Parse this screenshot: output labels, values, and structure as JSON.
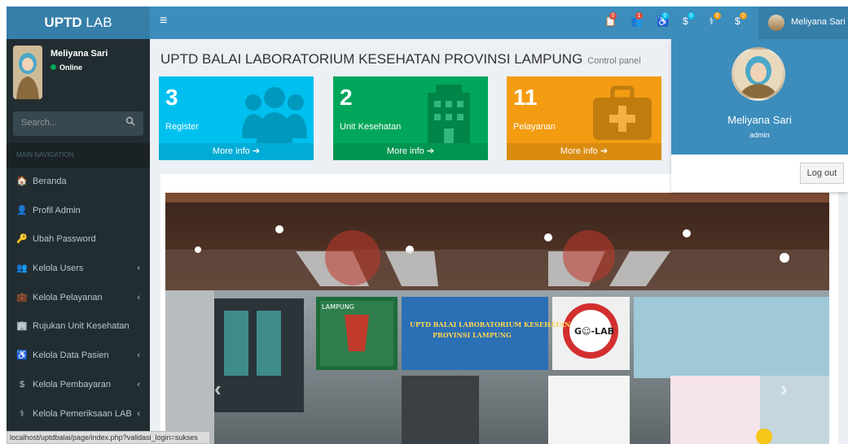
{
  "logo": {
    "bold": "UPTD",
    "rest": " LAB"
  },
  "sidebar": {
    "user_name": "Meliyana Sari",
    "status": "Online",
    "search_placeholder": "Search...",
    "nav_header": "MAIN NAVIGATION",
    "items": [
      {
        "label": "Beranda",
        "icon": "home-icon",
        "glyph": "🏠",
        "chevron": ""
      },
      {
        "label": "Profil Admin",
        "icon": "user-icon",
        "glyph": "👤",
        "chevron": ""
      },
      {
        "label": "Ubah Password",
        "icon": "key-icon",
        "glyph": "🔑",
        "chevron": ""
      },
      {
        "label": "Kelola Users",
        "icon": "users-icon",
        "glyph": "👥",
        "chevron": "‹"
      },
      {
        "label": "Kelola Pelayanan",
        "icon": "briefcase-medical-icon",
        "glyph": "💼",
        "chevron": "‹"
      },
      {
        "label": "Rujukan Unit Kesehatan",
        "icon": "building-icon",
        "glyph": "🏢",
        "chevron": ""
      },
      {
        "label": "Kelola Data Pasien",
        "icon": "wheelchair-icon",
        "glyph": "♿",
        "chevron": "‹"
      },
      {
        "label": "Kelola Pembayaran",
        "icon": "dollar-icon",
        "glyph": "$",
        "chevron": "‹"
      },
      {
        "label": "Kelola Pemeriksaan LAB",
        "icon": "stethoscope-icon",
        "glyph": "⚕",
        "chevron": "‹"
      }
    ]
  },
  "header": {
    "user_name": "Meliyana Sari",
    "notifications": [
      {
        "icon": "clipboard-icon",
        "glyph": "📋",
        "badge": "0",
        "color": "#dd4b39"
      },
      {
        "icon": "users-icon",
        "glyph": "👥",
        "badge": "1",
        "color": "#dd4b39"
      },
      {
        "icon": "wheelchair-icon",
        "glyph": "♿",
        "badge": "0",
        "color": "#00c0ef"
      },
      {
        "icon": "dollar-icon",
        "glyph": "$",
        "badge": "0",
        "color": "#00c0ef"
      },
      {
        "icon": "stethoscope-icon",
        "glyph": "⚕",
        "badge": "0",
        "color": "#f39c12"
      },
      {
        "icon": "dollar-icon",
        "glyph": "$",
        "badge": "0",
        "color": "#f39c12"
      }
    ]
  },
  "content": {
    "title": "UPTD BALAI LABORATORIUM KESEHATAN PROVINSI LAMPUNG",
    "subtitle": "Control panel",
    "boxes": [
      {
        "value": "3",
        "label": "Register",
        "more": "More info",
        "color": "#00c0ef",
        "icon": "users-icon"
      },
      {
        "value": "2",
        "label": "Unit Kesehatan",
        "more": "More info",
        "color": "#00a65a",
        "icon": "building-icon"
      },
      {
        "value": "11",
        "label": "Pelayanan",
        "more": "More info",
        "color": "#f39c12",
        "icon": "medkit-icon"
      }
    ]
  },
  "photo": {
    "sign_left": "LAMPUNG",
    "sign_center_1": "UPTD BALAI LABORATORIUM KESEHATAN",
    "sign_center_2": "PROVINSI LAMPUNG",
    "sign_right": "G☺-LAB"
  },
  "dropdown": {
    "name": "Meliyana Sari",
    "role": "admin",
    "logout": "Log out"
  },
  "statusbar": "localhost/uptdbalai/page/index.php?validasi_login=sukses"
}
